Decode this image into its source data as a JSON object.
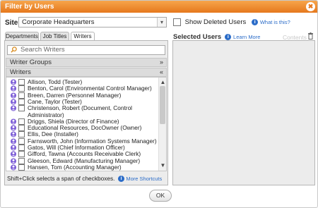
{
  "dialog": {
    "title": "Filter by Users"
  },
  "site": {
    "label": "Site",
    "value": "Corporate Headquarters"
  },
  "show_deleted": {
    "label": "Show Deleted Users",
    "help_link": "What is this?",
    "checked": false
  },
  "tabs": [
    {
      "label": "Departments",
      "active": false
    },
    {
      "label": "Job Titles",
      "active": false
    },
    {
      "label": "Writers",
      "active": true
    }
  ],
  "search": {
    "placeholder": "Search Writers"
  },
  "groups": [
    {
      "label": "Writer Groups",
      "chevron": "expand"
    },
    {
      "label": "Writers",
      "chevron": "collapse"
    }
  ],
  "writers": [
    "Allison, Todd (Tester)",
    "Benton, Carol (Environmental Control Manager)",
    "Breen, Darren (Personnel Manager)",
    "Cane, Taylor (Tester)",
    "Christenson, Robert (Document, Control",
    "Administrator)",
    "Driggs, Shiela (Director of Finance)",
    "Educational Resources, DocOwner (Owner)",
    "Ellis, Dee (Installer)",
    "Farnsworth, John (Information Systems Manager)",
    "Gatos, Will (Chief Information Officer)",
    "Gifford, Tawna (Accounts Receivable Clerk)",
    "Gleeson, Edward (Manufacturing Manager)",
    "Hansen, Tom (Accounting Manager)"
  ],
  "hint": {
    "text": "Shift+Click selects a span of checkboxes.",
    "link": "More Shortcuts"
  },
  "selected": {
    "title": "Selected Users",
    "learn_more": "Learn More",
    "contents": "Contents"
  },
  "footer": {
    "ok_label": "OK"
  },
  "colors": {
    "title_bar": "#e6781d",
    "link": "#2b6cc8",
    "user_icon": "#7b5cd6"
  }
}
